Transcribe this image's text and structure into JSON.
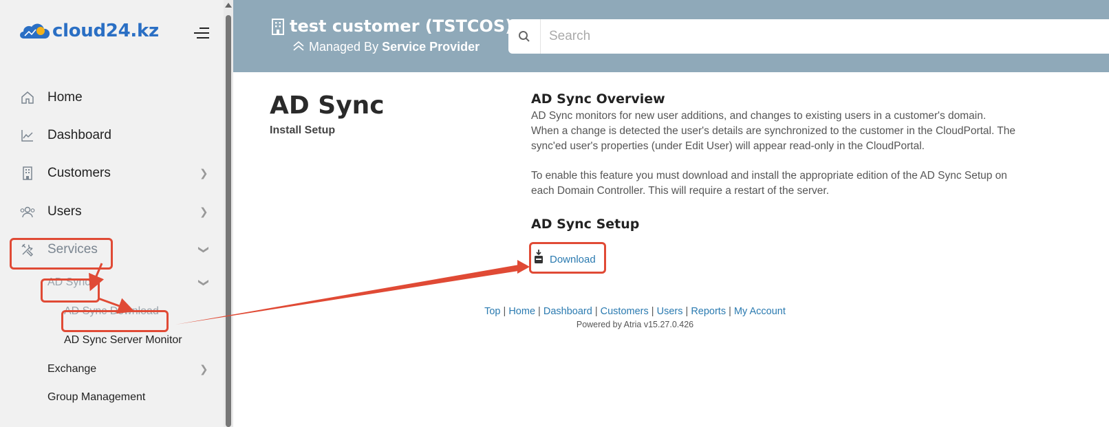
{
  "brand": {
    "logo_text": "cloud24.kz"
  },
  "sidebar": {
    "items": [
      {
        "label": "Home",
        "icon": "home-icon"
      },
      {
        "label": "Dashboard",
        "icon": "chart-line-icon"
      },
      {
        "label": "Customers",
        "icon": "building-icon"
      },
      {
        "label": "Users",
        "icon": "users-icon"
      },
      {
        "label": "Services",
        "icon": "tools-icon"
      }
    ],
    "services_sub": {
      "ad_sync": "AD Sync",
      "ad_sync_download": "AD Sync Download",
      "ad_sync_server_monitor": "AD Sync Server Monitor",
      "exchange": "Exchange",
      "group_management": "Group Management"
    }
  },
  "header": {
    "customer_title": "test customer (TSTCOS)",
    "managed_prefix": "Managed By",
    "managed_by": "Service Provider",
    "search_placeholder": "Search"
  },
  "main": {
    "title": "AD Sync",
    "subtitle": "Install Setup",
    "overview_title": "AD Sync Overview",
    "overview_lines": [
      "AD Sync monitors for new user additions, and changes to existing users in a customer's domain.",
      "When a change is detected the user's details are synchronized to the customer in the CloudPortal. The",
      "sync'ed user's properties (under Edit User) will appear read-only in the CloudPortal."
    ],
    "enable_lines": [
      "To enable this feature you must download and install the appropriate edition of the AD Sync Setup on",
      "each Domain Controller. This will require a restart of the server."
    ],
    "setup_title": "AD Sync Setup",
    "download_label": "Download"
  },
  "footer": {
    "links": [
      "Top",
      "Home",
      "Dashboard",
      "Customers",
      "Users",
      "Reports",
      "My Account"
    ],
    "separator": "|",
    "powered_by": "Powered by Atria v15.27.0.426"
  },
  "colors": {
    "header_bg": "#8fa9b9",
    "sidebar_bg": "#f1f1f1",
    "link": "#2a7ab0",
    "annotation": "#e04a35",
    "brand": "#2a6fc4"
  }
}
